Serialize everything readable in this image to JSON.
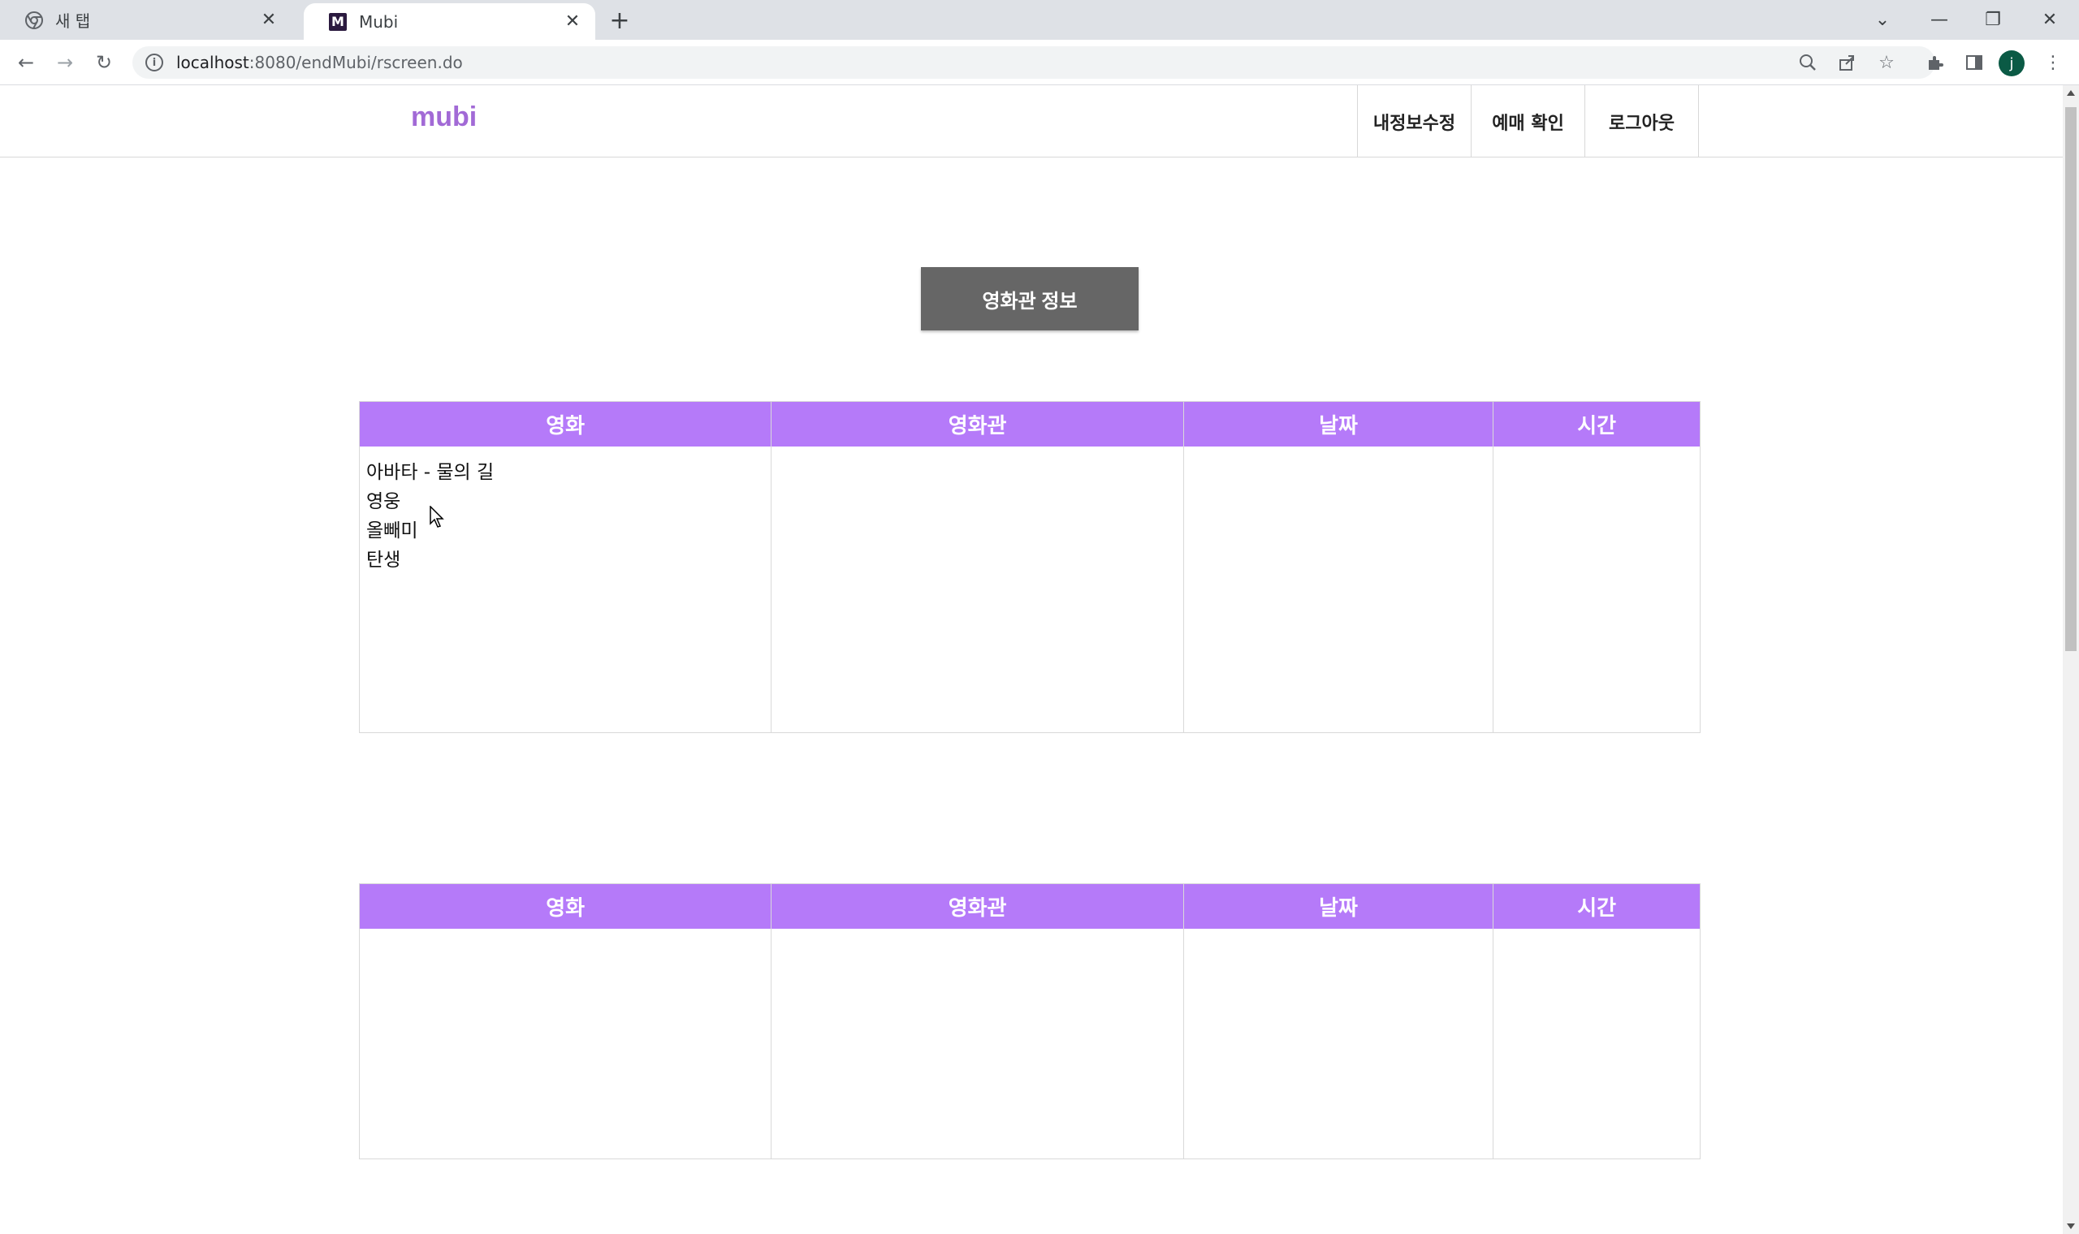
{
  "browser": {
    "tabs": [
      {
        "title": "새 탭",
        "active": false,
        "icon": "chrome-icon"
      },
      {
        "title": "Mubi",
        "active": true,
        "icon": "mubi-favicon"
      }
    ],
    "address": {
      "host": "localhost",
      "rest": ":8080/endMubi/rscreen.do"
    },
    "profile_initial": "j"
  },
  "site": {
    "logo": "mubi",
    "nav": [
      "내정보수정",
      "예매 확인",
      "로그아웃"
    ]
  },
  "main": {
    "info_button": "영화관 정보",
    "table_headers": [
      "영화",
      "영화관",
      "날짜",
      "시간"
    ],
    "movies": [
      "아바타 - 물의 길",
      "영웅",
      "올빼미",
      "탄생"
    ]
  },
  "colors": {
    "header_purple": "#b57af9",
    "button_gray": "#666666",
    "logo_purple": "#a26ad6"
  }
}
